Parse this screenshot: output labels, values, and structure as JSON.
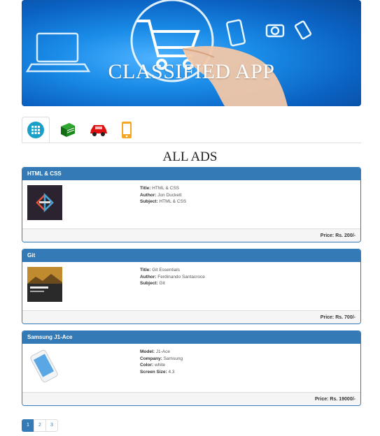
{
  "banner": {
    "title": "CLASSIFIED APP"
  },
  "tabs": [
    {
      "name": "all",
      "icon": "grid-icon",
      "color": "#1aa0c8"
    },
    {
      "name": "books",
      "icon": "book-icon",
      "color": "#1a8a1a"
    },
    {
      "name": "cars",
      "icon": "car-icon",
      "color": "#e01010"
    },
    {
      "name": "mobiles",
      "icon": "mobile-icon",
      "color": "#f5a623"
    }
  ],
  "section_title": "ALL ADS",
  "ads": [
    {
      "heading": "HTML & CSS",
      "fields": [
        {
          "label": "Title:",
          "value": "HTML & CSS"
        },
        {
          "label": "Author:",
          "value": "Jon Duckett"
        },
        {
          "label": "Subject:",
          "value": "HTML & CSS"
        }
      ],
      "price": "Price: Rs. 200/-"
    },
    {
      "heading": "Git",
      "fields": [
        {
          "label": "Title:",
          "value": "Git Essentials"
        },
        {
          "label": "Author:",
          "value": "Ferdinando Santacroce"
        },
        {
          "label": "Subject:",
          "value": "Git"
        }
      ],
      "price": "Price: Rs. 700/-"
    },
    {
      "heading": "Samsung J1-Ace",
      "fields": [
        {
          "label": "Model:",
          "value": "J1-Ace"
        },
        {
          "label": "Company:",
          "value": "Samsung"
        },
        {
          "label": "Color:",
          "value": "white"
        },
        {
          "label": "Screen Size:",
          "value": "4.3"
        }
      ],
      "price": "Price: Rs. 19000/-"
    }
  ],
  "pagination": {
    "pages": [
      "1",
      "2",
      "3"
    ],
    "active": "1"
  }
}
